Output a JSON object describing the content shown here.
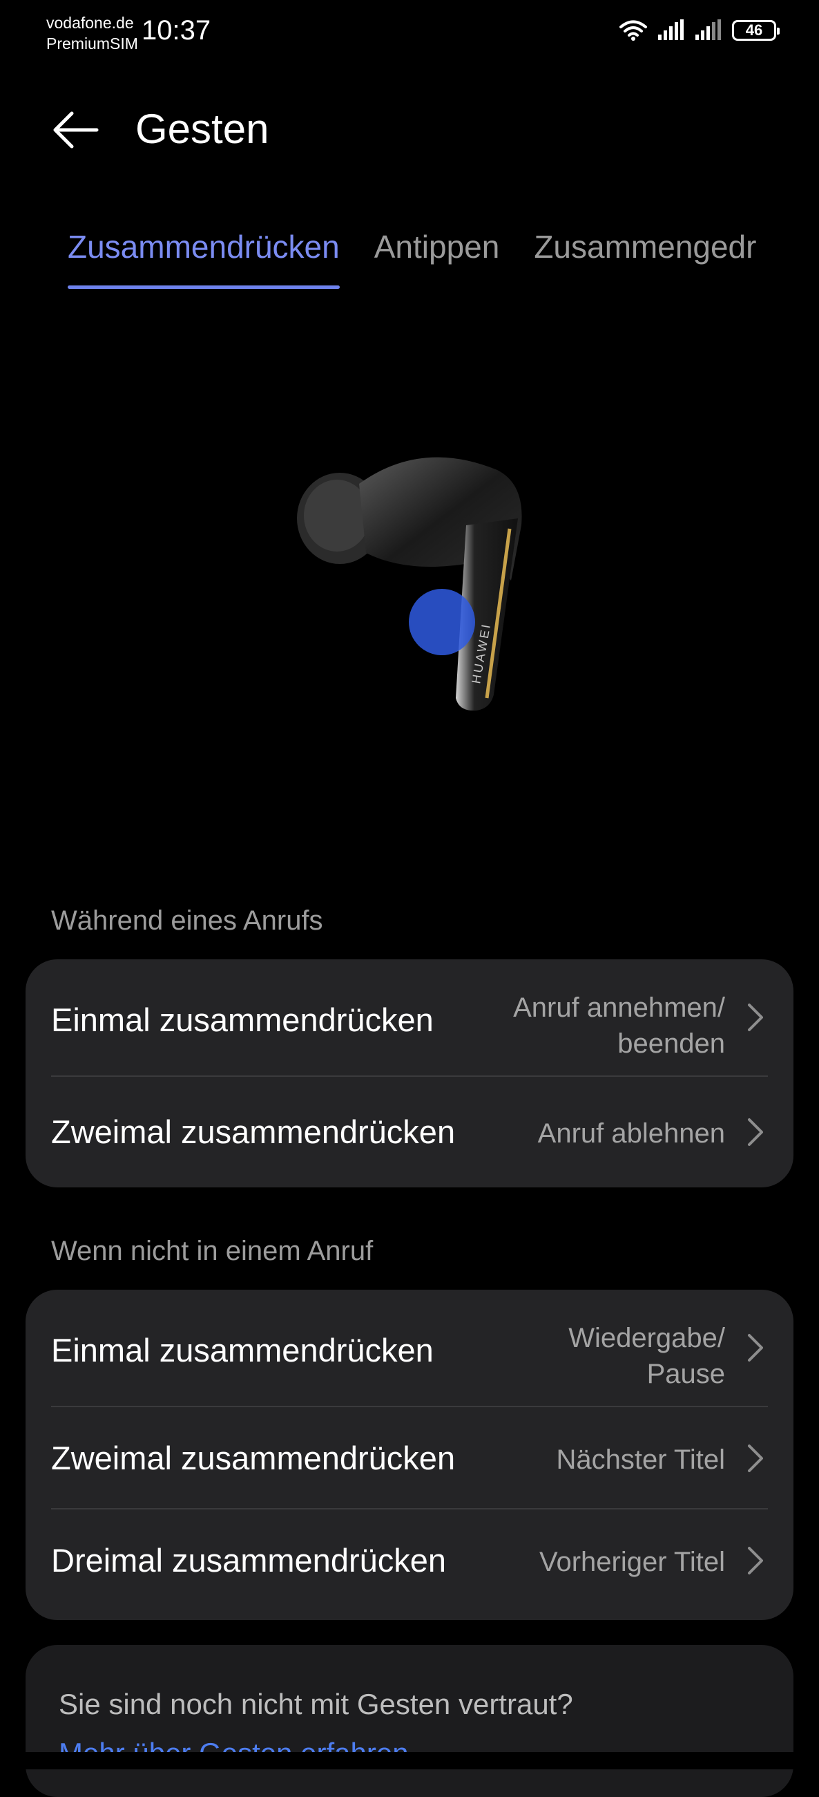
{
  "status_bar": {
    "carrier_line1": "vodafone.de",
    "carrier_line2": "PremiumSIM",
    "time": "10:37",
    "battery": "46",
    "icons": [
      "wifi-icon",
      "signal-icon",
      "signal-icon",
      "battery-icon"
    ]
  },
  "header": {
    "back_icon": "back-arrow-icon",
    "title": "Gesten"
  },
  "tabs": [
    {
      "label": "Zusammendrücken",
      "active": true
    },
    {
      "label": "Antippen",
      "active": false
    },
    {
      "label": "Zusammengedr",
      "active": false
    }
  ],
  "illustration": {
    "brand": "HUAWEI"
  },
  "during_call": {
    "label": "Während eines Anrufs",
    "rows": [
      {
        "title": "Einmal zusammendrücken",
        "value_line1": "Anruf annehmen/",
        "value_line2": "beenden"
      },
      {
        "title": "Zweimal zusammendrücken",
        "value": "Anruf ablehnen"
      }
    ]
  },
  "not_in_call": {
    "label": "Wenn nicht in einem Anruf",
    "rows": [
      {
        "title": "Einmal zusammendrücken",
        "value_line1": "Wiedergabe/",
        "value_line2": "Pause"
      },
      {
        "title": "Zweimal zusammendrücken",
        "value": "Nächster Titel"
      },
      {
        "title": "Dreimal zusammendrücken",
        "value": "Vorheriger Titel"
      }
    ]
  },
  "hint": {
    "text": "Sie sind noch nicht mit Gesten vertraut?",
    "link": "Mehr über Gesten erfahren"
  },
  "colors": {
    "accent": "#7b8cf2",
    "card": "#242426",
    "link": "#4d7df0"
  }
}
